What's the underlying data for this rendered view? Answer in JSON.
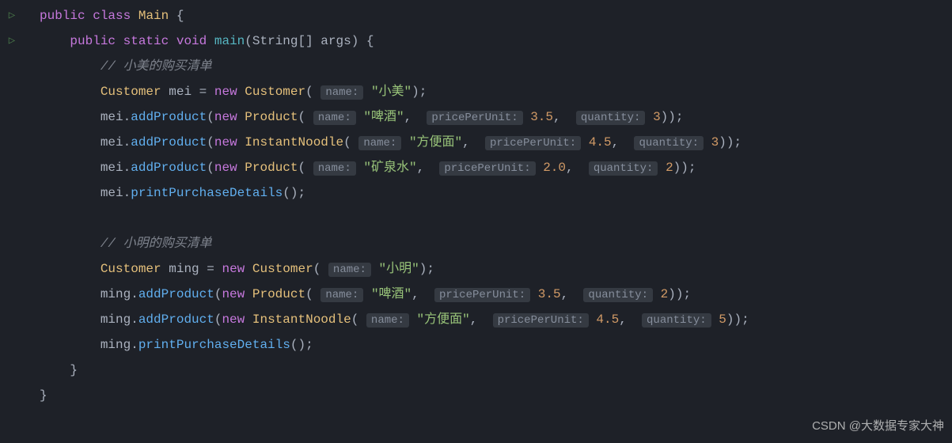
{
  "code": {
    "kw_public1": "public",
    "kw_class": "class",
    "classname": "Main",
    "kw_public2": "public",
    "kw_static": "static",
    "kw_void": "void",
    "main": "main",
    "params": "(String[] args)",
    "comment1": "// 小美的购买清单",
    "cust_type": "Customer",
    "mei_var": "mei",
    "kw_new": "new",
    "product_type": "Product",
    "instant_type": "InstantNoodle",
    "hint_name": "name:",
    "hint_price": "pricePerUnit:",
    "hint_qty": "quantity:",
    "str_xiaomei": "\"小美\"",
    "str_beer": "\"啤酒\"",
    "str_noodle": "\"方便面\"",
    "str_water": "\"矿泉水\"",
    "num_3_5": "3.5",
    "num_4_5": "4.5",
    "num_2_0": "2.0",
    "num_3": "3",
    "num_2": "2",
    "num_5": "5",
    "addProduct": "addProduct",
    "printDetails": "printPurchaseDetails",
    "comment2": "// 小明的购买清单",
    "ming_var": "ming",
    "str_xiaoming": "\"小明\""
  },
  "watermark": "CSDN @大数据专家大神"
}
